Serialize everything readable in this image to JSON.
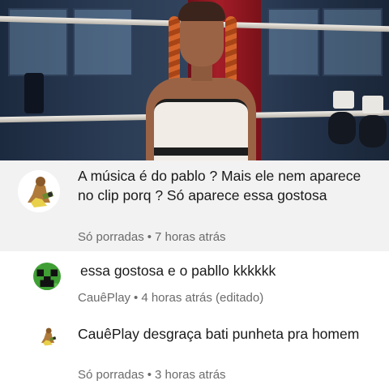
{
  "comments": [
    {
      "text": "A música é do pablo ? Mais ele nem aparece no clip porq ?  Só aparece essa gostosa",
      "author": "Só porradas",
      "separator": "•",
      "time": "7 horas atrás",
      "avatar_icon": "cartoon-character-icon"
    },
    {
      "text": "essa gostosa e o pabllo kkkkkk",
      "author": "CauêPlay",
      "separator": "•",
      "time": "4 horas atrás (editado)",
      "avatar_icon": "green-creeper-face-icon"
    },
    {
      "text": "CauêPlay desgraça bati punheta pra homem",
      "author": "Só porradas",
      "separator": "•",
      "time": "3 horas atrás",
      "avatar_icon": "cartoon-character-icon"
    }
  ],
  "colors": {
    "highlight_background": "#f2f2f2",
    "text": "#1a1a1a",
    "meta_text": "#6b6b6b",
    "creeper_green": "#3f9f34"
  }
}
